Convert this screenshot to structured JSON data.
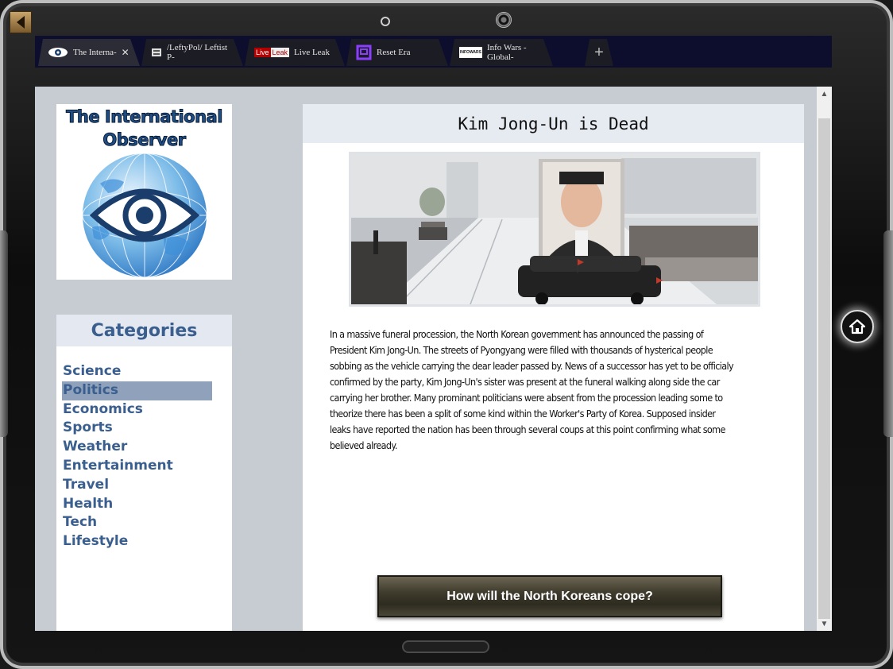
{
  "browser": {
    "tabs": [
      {
        "title": "The Interna-",
        "icon": "eye-logo-icon",
        "active": true,
        "close": "✕"
      },
      {
        "title": "/LeftyPol/ Leftist P-",
        "icon": "imageboard-icon",
        "active": false
      },
      {
        "title": "Live Leak",
        "icon": "liveleak-logo-icon",
        "logo_text_1": "Live",
        "logo_text_2": "Leak",
        "active": false
      },
      {
        "title": "Reset Era",
        "icon": "reset-era-icon",
        "active": false
      },
      {
        "title": "Info Wars - Global-",
        "icon": "infowars-logo-icon",
        "logo_text": "INFOWARS",
        "active": false
      }
    ],
    "new_tab": "+"
  },
  "site": {
    "logo_line1": "The International",
    "logo_line2": "Observer"
  },
  "categories": {
    "header": "Categories",
    "items": [
      "Science",
      "Politics",
      "Economics",
      "Sports",
      "Weather",
      "Entertainment",
      "Travel",
      "Health",
      "Tech",
      "Lifestyle"
    ],
    "selected": "Politics"
  },
  "article": {
    "title": "Kim Jong-Un is Dead",
    "body": "In a massive funeral procession, the North Korean government has announced the passing of President Kim Jong-Un. The streets of Pyongyang were filled with thousands of hysterical people sobbing as the vehicle carrying the dear leader passed by. News of a successor has yet to be officialy confirmed by the party, Kim Jong-Un's sister was present at the funeral walking along side the car carrying her brother. Many prominant politicians were absent from the procession leading some to theorize there has been a split of some kind within the Worker's Party of Korea. Supposed insider leaks have reported the nation has been through several coups at this point confirming what some believed already.",
    "cta": "How will the North Koreans cope?"
  },
  "colors": {
    "accent": "#3a5f8f",
    "selected_bg": "#8fa1bb",
    "page_bg": "#c7ccd3",
    "tabbar_bg": "#0d0d2e"
  }
}
